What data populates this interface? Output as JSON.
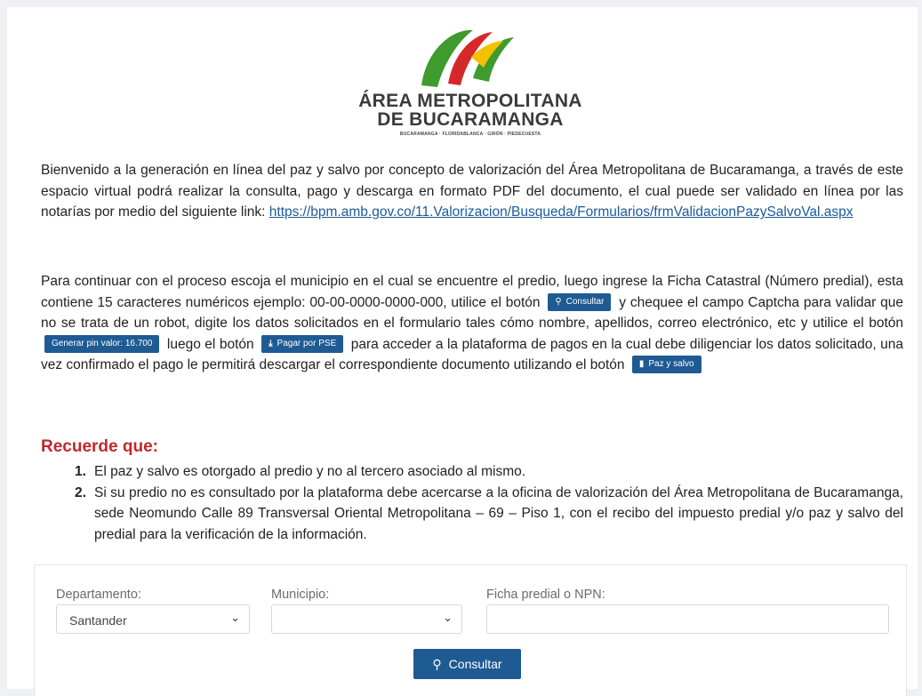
{
  "logo": {
    "line1": "ÁREA METROPOLITANA",
    "line2": "DE BUCARAMANGA",
    "tagline": "BUCARAMANGA · FLORIDABLANCA · GIRÓN · PIEDECUESTA",
    "colors": {
      "green": "#3f9b2e",
      "red": "#d62828",
      "yellow": "#f2c200"
    }
  },
  "intro": {
    "text_before_link": "Bienvenido a la generación en línea del paz y salvo por concepto de valorización del Área Metropolitana de Bucaramanga, a través de este espacio virtual podrá realizar la consulta, pago y descarga en formato PDF del documento, el cual puede ser validado en línea por las notarías por medio del siguiente link:",
    "link": "https://bpm.amb.gov.co/11.Valorizacion/Busqueda/Formularios/frmValidacionPazySalvoVal.aspx"
  },
  "instructions": {
    "part1": "Para continuar con el proceso escoja el municipio en el cual se encuentre el predio, luego ingrese la Ficha Catastral (Número predial), esta contiene 15 caracteres numéricos ejemplo: 00-00-0000-0000-000, utilice el botón",
    "btn_consultar": "Consultar",
    "part2": "y chequee el campo Captcha para validar que no se trata de un robot, digite los datos solicitados en el formulario tales cómo nombre, apellidos, correo electrónico, etc y utilice el botón",
    "btn_pin": "Generar pin valor: 16.700",
    "part3": "luego el botón",
    "btn_pse": "Pagar por PSE",
    "part4": "para acceder a la plataforma de pagos en la cual debe diligenciar los datos solicitado, una vez confirmado el pago le permitirá descargar el correspondiente documento utilizando el botón",
    "btn_paz": "Paz y salvo"
  },
  "reminder": {
    "title": "Recuerde que:",
    "items": [
      {
        "num": "1.",
        "text": "El paz y salvo es otorgado al predio y no al tercero asociado al mismo."
      },
      {
        "num": "2.",
        "text": "Si su predio no es consultado por la plataforma debe acercarse a la oficina de valorización del Área Metropolitana de Bucaramanga, sede Neomundo Calle 89 Transversal Oriental Metropolitana – 69 – Piso 1, con el recibo del impuesto predial y/o paz y salvo del predial para la verificación de la información."
      }
    ]
  },
  "form": {
    "departamento_label": "Departamento:",
    "departamento_value": "Santander",
    "municipio_label": "Municipio:",
    "municipio_value": "",
    "ficha_label": "Ficha predial o NPN:",
    "ficha_value": "",
    "consultar_label": "Consultar"
  },
  "accent_color": "#1e5b93",
  "reminder_color": "#c0282d"
}
